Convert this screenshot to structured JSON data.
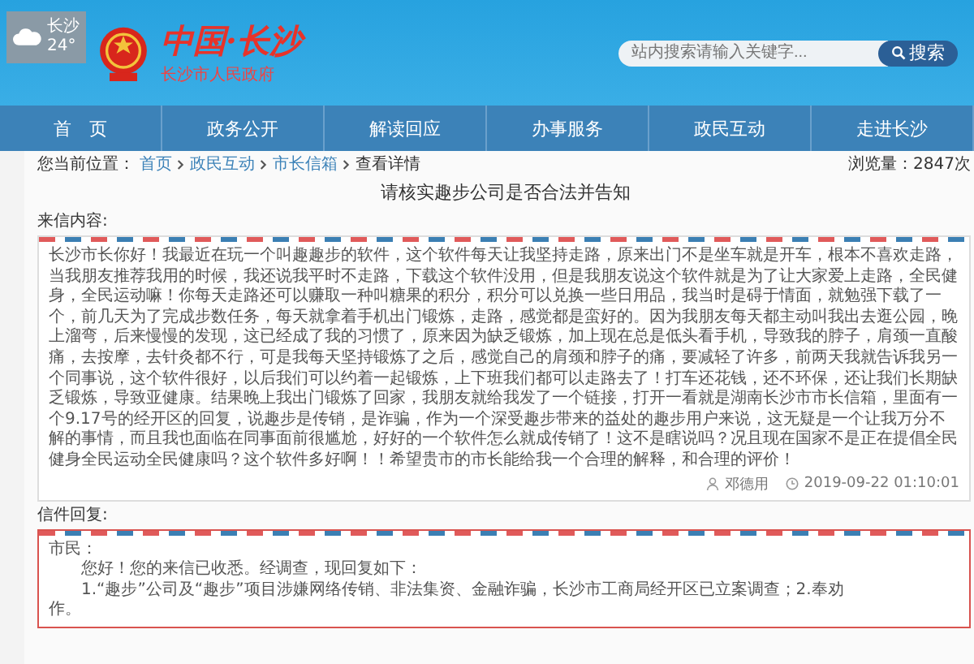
{
  "weather": {
    "city": "长沙",
    "temp": "24°"
  },
  "logo": {
    "title": "中国·长沙",
    "subtitle": "长沙市人民政府"
  },
  "search": {
    "placeholder": "站内搜索请输入关键字...",
    "button": "搜索"
  },
  "nav": [
    {
      "label": "首　页"
    },
    {
      "label": "政务公开"
    },
    {
      "label": "解读回应"
    },
    {
      "label": "办事服务"
    },
    {
      "label": "政民互动"
    },
    {
      "label": "走进长沙"
    }
  ],
  "breadcrumb": {
    "prefix": "您当前位置：",
    "links": [
      "首页",
      "政民互动",
      "市长信箱"
    ],
    "current": "查看详情",
    "views": "浏览量：2847次"
  },
  "title": "请核实趣步公司是否合法并告知",
  "letter": {
    "heading": "来信内容:",
    "body": "长沙市长你好！我最近在玩一个叫趣趣步的软件，这个软件每天让我坚持走路，原来出门不是坐车就是开车，根本不喜欢走路，当我朋友推荐我用的时候，我还说我平时不走路，下载这个软件没用，但是我朋友说这个软件就是为了让大家爱上走路，全民健身，全民运动嘛！你每天走路还可以赚取一种叫糖果的积分，积分可以兑换一些日用品，我当时是碍于情面，就勉强下载了一个，前几天为了完成步数任务，每天就拿着手机出门锻炼，走路，感觉都是蛮好的。因为我朋友每天都主动叫我出去逛公园，晚上溜弯，后来慢慢的发现，这已经成了我的习惯了，原来因为缺乏锻炼，加上现在总是低头看手机，导致我的脖子，肩颈一直酸痛，去按摩，去针灸都不行，可是我每天坚持锻炼了之后，感觉自己的肩颈和脖子的痛，要减轻了许多，前两天我就告诉我另一个同事说，这个软件很好，以后我们可以约着一起锻炼，上下班我们都可以走路去了！打车还花钱，还不环保，还让我们长期缺乏锻炼，导致亚健康。结果晚上我出门锻炼了回家，我朋友就给我发了一个链接，打开一看就是湖南长沙市市长信箱，里面有一个9.17号的经开区的回复，说趣步是传销，是诈骗，作为一个深受趣步带来的益处的趣步用户来说，这无疑是一个让我万分不解的事情，而且我也面临在同事面前很尴尬，好好的一个软件怎么就成传销了！这不是瞎说吗？况且现在国家不是正在提倡全民健身全民运动全民健康吗？这个软件多好啊！！希望贵市的市长能给我一个合理的解释，和合理的评价！",
    "author": "邓德用",
    "time": "2019-09-22 01:10:01"
  },
  "reply": {
    "heading": "信件回复:",
    "lines": [
      "市民：",
      "您好！您的来信已收悉。经调查，现回复如下：",
      "1.“趣步”公司及“趣步”项目涉嫌网络传销、非法集资、金融诈骗，长沙市工商局经开区已立案调查；2.奉劝",
      "作。"
    ]
  }
}
